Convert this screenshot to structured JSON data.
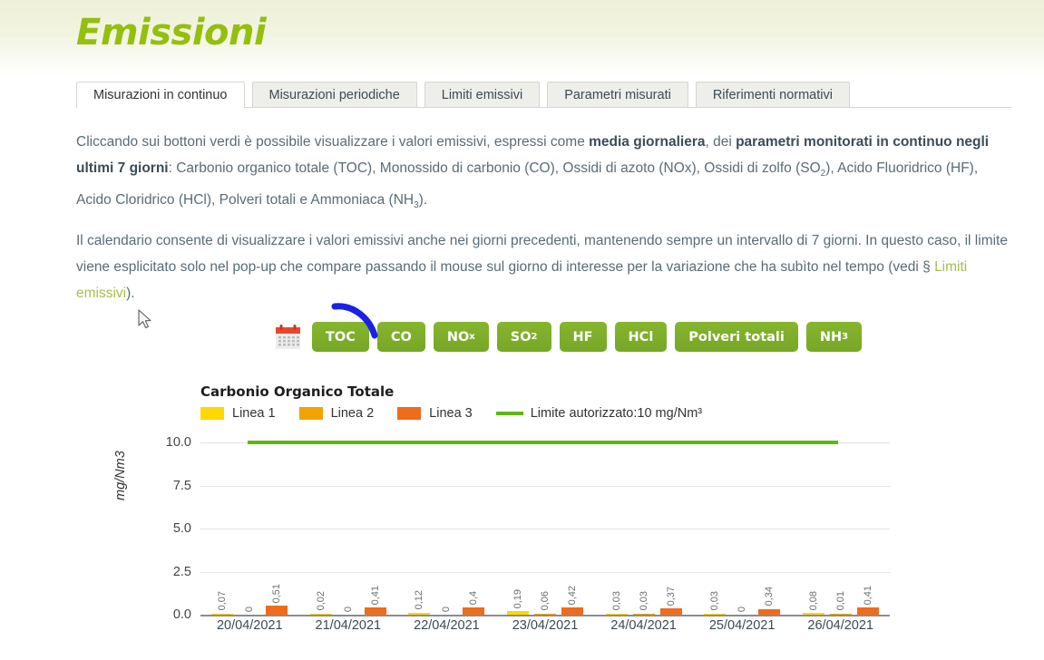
{
  "header": {
    "title": "Emissioni"
  },
  "tabs": [
    {
      "label": "Misurazioni in continuo",
      "active": true
    },
    {
      "label": "Misurazioni periodiche",
      "active": false
    },
    {
      "label": "Limiti emissivi",
      "active": false
    },
    {
      "label": "Parametri misurati",
      "active": false
    },
    {
      "label": "Riferimenti normativi",
      "active": false
    }
  ],
  "paragraphs": {
    "p1_a": "Cliccando sui bottoni verdi è possibile visualizzare i valori emissivi, espressi come ",
    "p1_b": "media giornaliera",
    "p1_c": ", dei ",
    "p1_d": "parametri monitorati in continuo negli ultimi 7 giorni",
    "p1_e": ": Carbonio organico totale (TOC), Monossido di carbonio (CO), Ossidi di azoto (NOx), Ossidi di zolfo (SO",
    "p1_f": "2",
    "p1_g": "), Acido Fluoridrico (HF), Acido Cloridrico (HCl), Polveri totali e Ammoniaca (NH",
    "p1_h": "3",
    "p1_i": ").",
    "p2_a": "Il calendario consente di visualizzare i valori emissivi anche nei giorni precedenti, mantenendo sempre un intervallo di 7 giorni. In questo caso, il limite viene esplicitato solo nel pop-up che compare passando il mouse sul giorno di interesse per la variazione che ha subìto nel tempo (vedi § ",
    "p2_link": "Limiti emissivi",
    "p2_b": ")."
  },
  "controls": {
    "calendar_icon": "calendar-icon",
    "buttons": [
      {
        "label": "TOC",
        "sub": "",
        "active": true
      },
      {
        "label": "CO",
        "sub": "",
        "active": false
      },
      {
        "label": "NO",
        "sub": "x",
        "active": false
      },
      {
        "label": "SO",
        "sub": "2",
        "active": false
      },
      {
        "label": "HF",
        "sub": "",
        "active": false
      },
      {
        "label": "HCl",
        "sub": "",
        "active": false
      },
      {
        "label": "Polveri totali",
        "sub": "",
        "active": false
      },
      {
        "label": "NH",
        "sub": "3",
        "active": false
      }
    ],
    "button_color": "#7cad29"
  },
  "chart_data": {
    "type": "bar",
    "title": "Carbonio Organico Totale",
    "xlabel": "",
    "ylabel": "mg/Nm3",
    "ylim": [
      0,
      10
    ],
    "yticks": [
      "0.0",
      "2.5",
      "5.0",
      "7.5",
      "10.0"
    ],
    "grid": true,
    "legend_position": "top",
    "categories": [
      "20/04/2021",
      "21/04/2021",
      "22/04/2021",
      "23/04/2021",
      "24/04/2021",
      "25/04/2021",
      "26/04/2021"
    ],
    "series": [
      {
        "name": "Linea 1",
        "color": "#ffd800",
        "values": [
          0.07,
          0.02,
          0.12,
          0.19,
          0.03,
          0.03,
          0.08
        ],
        "labels": [
          "0,07",
          "0,02",
          "0,12",
          "0,19",
          "0,03",
          "0,03",
          "0,08"
        ]
      },
      {
        "name": "Linea 2",
        "color": "#f2a300",
        "values": [
          0,
          0,
          0,
          0.06,
          0.03,
          0,
          0.01
        ],
        "labels": [
          "0",
          "0",
          "0",
          "0,06",
          "0,03",
          "0",
          "0,01"
        ]
      },
      {
        "name": "Linea 3",
        "color": "#ef6c1a",
        "values": [
          0.51,
          0.41,
          0.4,
          0.42,
          0.37,
          0.34,
          0.41
        ],
        "labels": [
          "0,51",
          "0,41",
          "0,4",
          "0,42",
          "0,37",
          "0,34",
          "0,41"
        ]
      }
    ],
    "limit": {
      "label": "Limite autorizzato:10 mg/Nm³",
      "value": 10,
      "color": "#5cb811"
    }
  },
  "annotations": {
    "blue_arrow": "blue-curved-arrow",
    "cursor": "mouse-pointer"
  }
}
